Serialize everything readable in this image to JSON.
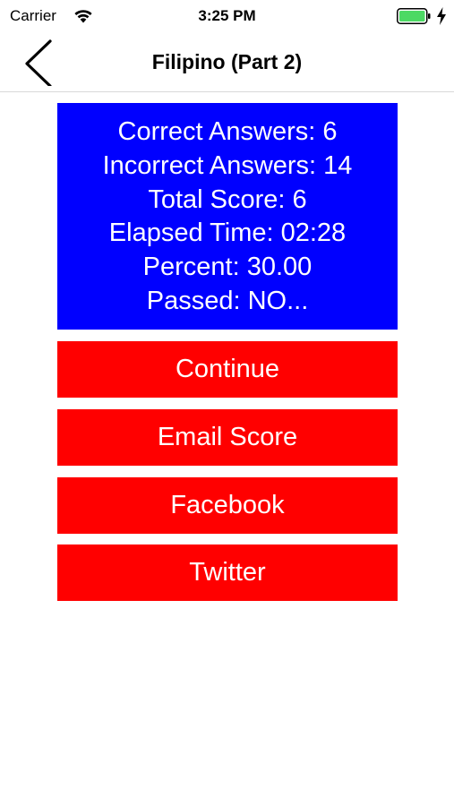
{
  "status_bar": {
    "carrier": "Carrier",
    "time": "3:25 PM",
    "battery_color": "#4cd964"
  },
  "nav": {
    "back_icon": "chevron-left-icon",
    "title": "Filipino (Part 2)"
  },
  "score": {
    "background": "#0000ff",
    "lines": [
      "Correct Answers: 6",
      "Incorrect Answers: 14",
      "Total Score: 6",
      "Elapsed Time: 02:28",
      "Percent: 30.00",
      "Passed: NO..."
    ]
  },
  "buttons": {
    "color": "#ff0000",
    "continue": "Continue",
    "email": "Email Score",
    "facebook": "Facebook",
    "twitter": "Twitter"
  }
}
